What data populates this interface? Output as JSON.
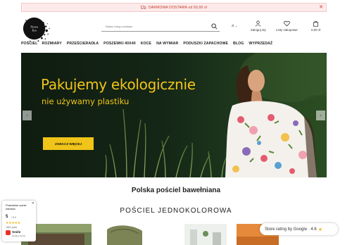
{
  "promo": {
    "text": "DARMOWA DOSTAWA od 50,00 zł",
    "close": "✕"
  },
  "logo": {
    "line1": "Nowa",
    "line2": "Era"
  },
  "search": {
    "placeholder": "Wpisz czego szukasz"
  },
  "header": {
    "currency": "zł",
    "login_label": "Zaloguj się",
    "wishlist_label": "Listy zakupowe",
    "cart_label": "0,00 zł"
  },
  "nav": {
    "items": [
      "POŚCIEL",
      "ROZMIARY",
      "PRZEŚCIERADŁA",
      "POSZEWKI 40X40",
      "KOCE",
      "NA WYMIAR",
      "PODUSZKI ZAPACHOWE",
      "BLOG",
      "WYPRZEDAŻ"
    ]
  },
  "hero": {
    "title": "Pakujemy ekologicznie",
    "subtitle": "nie używamy plastiku",
    "button": "ZOBACZ WIĘCEJ",
    "prev": "‹",
    "next": "›"
  },
  "sections": {
    "title": "Polska pościel bawełniana",
    "subtitle": "POŚCIEL JEDNOKOLOROWA"
  },
  "review_badge": {
    "title": "Prawdziwe opinie klientów",
    "score": "5",
    "of": "/ 5.0",
    "stars": "★★★★★",
    "count": "1561 opinii",
    "brand": "Smile",
    "brand_sub": "Zaufane Opinie",
    "close": "✕"
  },
  "google_rating": {
    "text": "Store rating by Google · 4.6",
    "star": "★"
  },
  "colors": {
    "accent_yellow": "#f0c419",
    "promo_red": "#c0392b",
    "promo_bg": "#fdeaea",
    "star": "#f1b814"
  }
}
